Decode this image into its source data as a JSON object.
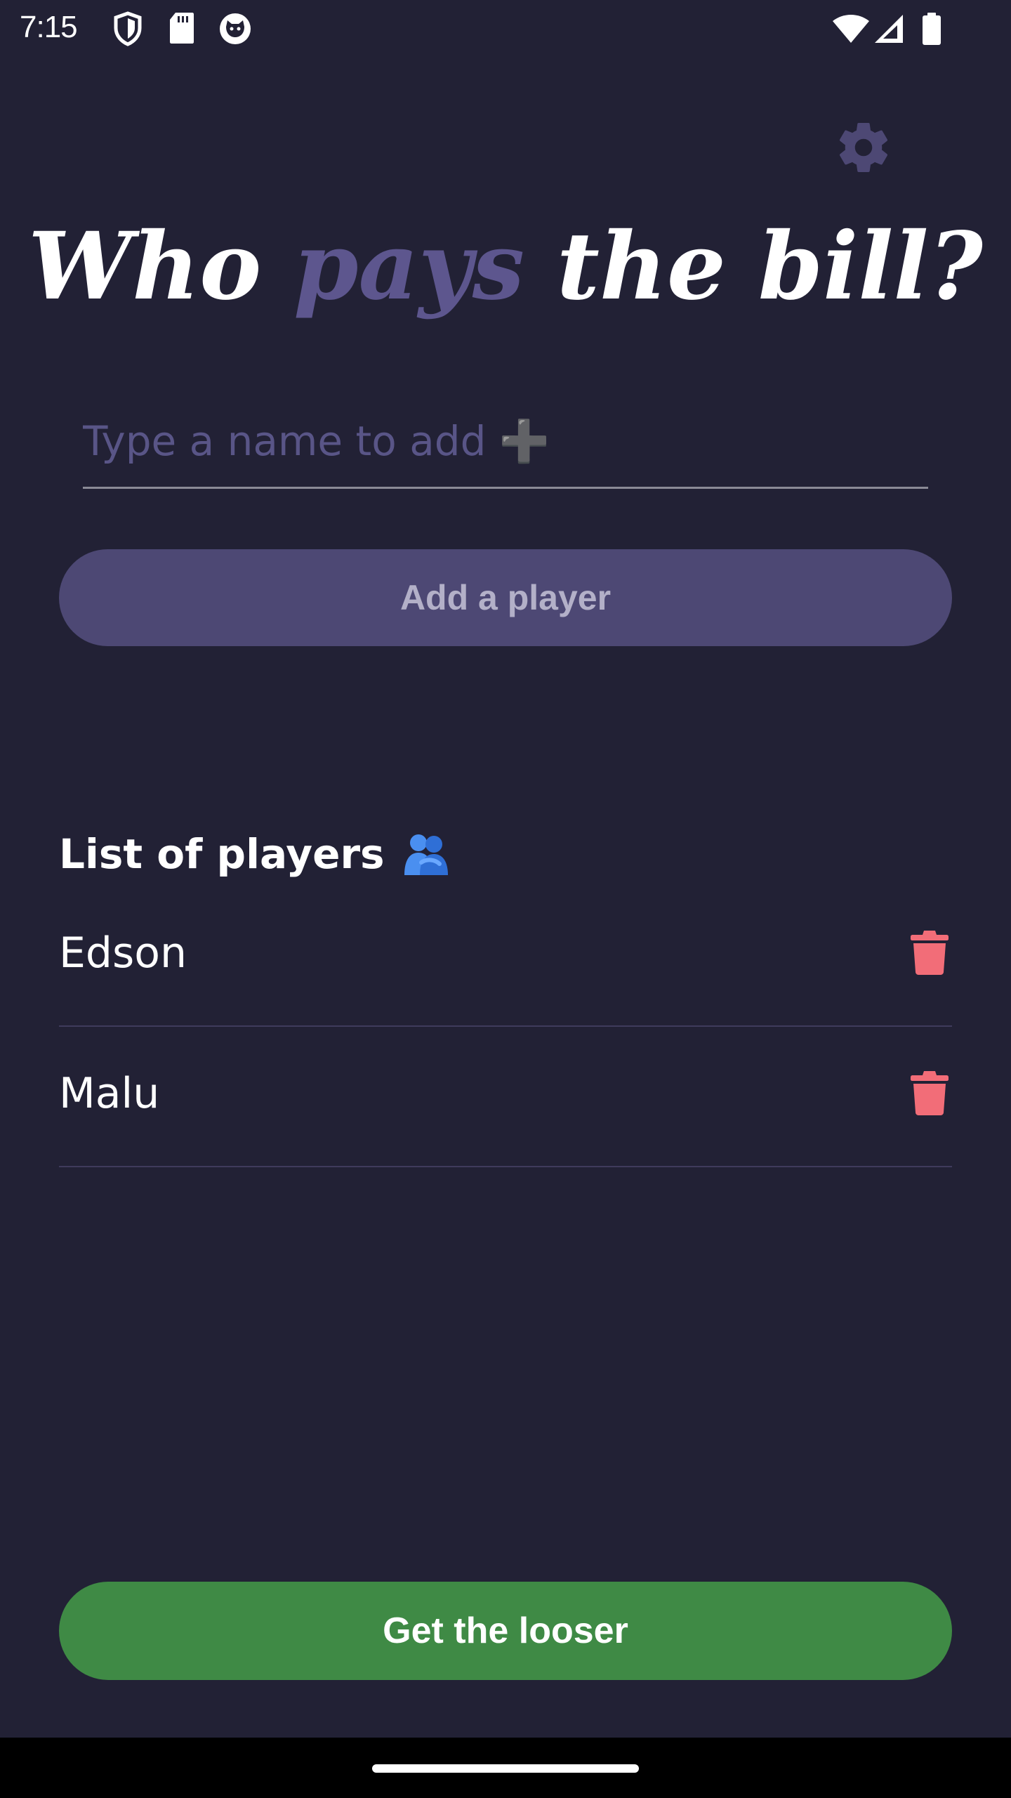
{
  "status_bar": {
    "time": "7:15",
    "icons": [
      "shield-icon",
      "sd-card-icon",
      "cat-face-icon",
      "wifi-icon",
      "signal-icon",
      "battery-icon"
    ]
  },
  "header": {
    "settings_icon": "gear-icon",
    "title_part1": "Who ",
    "title_accent": "pays",
    "title_part2": " the bill?"
  },
  "form": {
    "name_placeholder": "Type a name to add ➕",
    "name_value": "",
    "add_button_label": "Add a player"
  },
  "players": {
    "heading": "List of players",
    "heading_icon": "people-hugging-icon",
    "items": [
      {
        "name": "Edson",
        "delete_icon": "trash-icon"
      },
      {
        "name": "Malu",
        "delete_icon": "trash-icon"
      }
    ]
  },
  "footer": {
    "looser_button_label": "Get the looser"
  },
  "colors": {
    "background": "#222135",
    "accent": "#5d568e",
    "add_button": "#4d4874",
    "looser_button": "#3f8a45",
    "delete": "#f26d78"
  }
}
